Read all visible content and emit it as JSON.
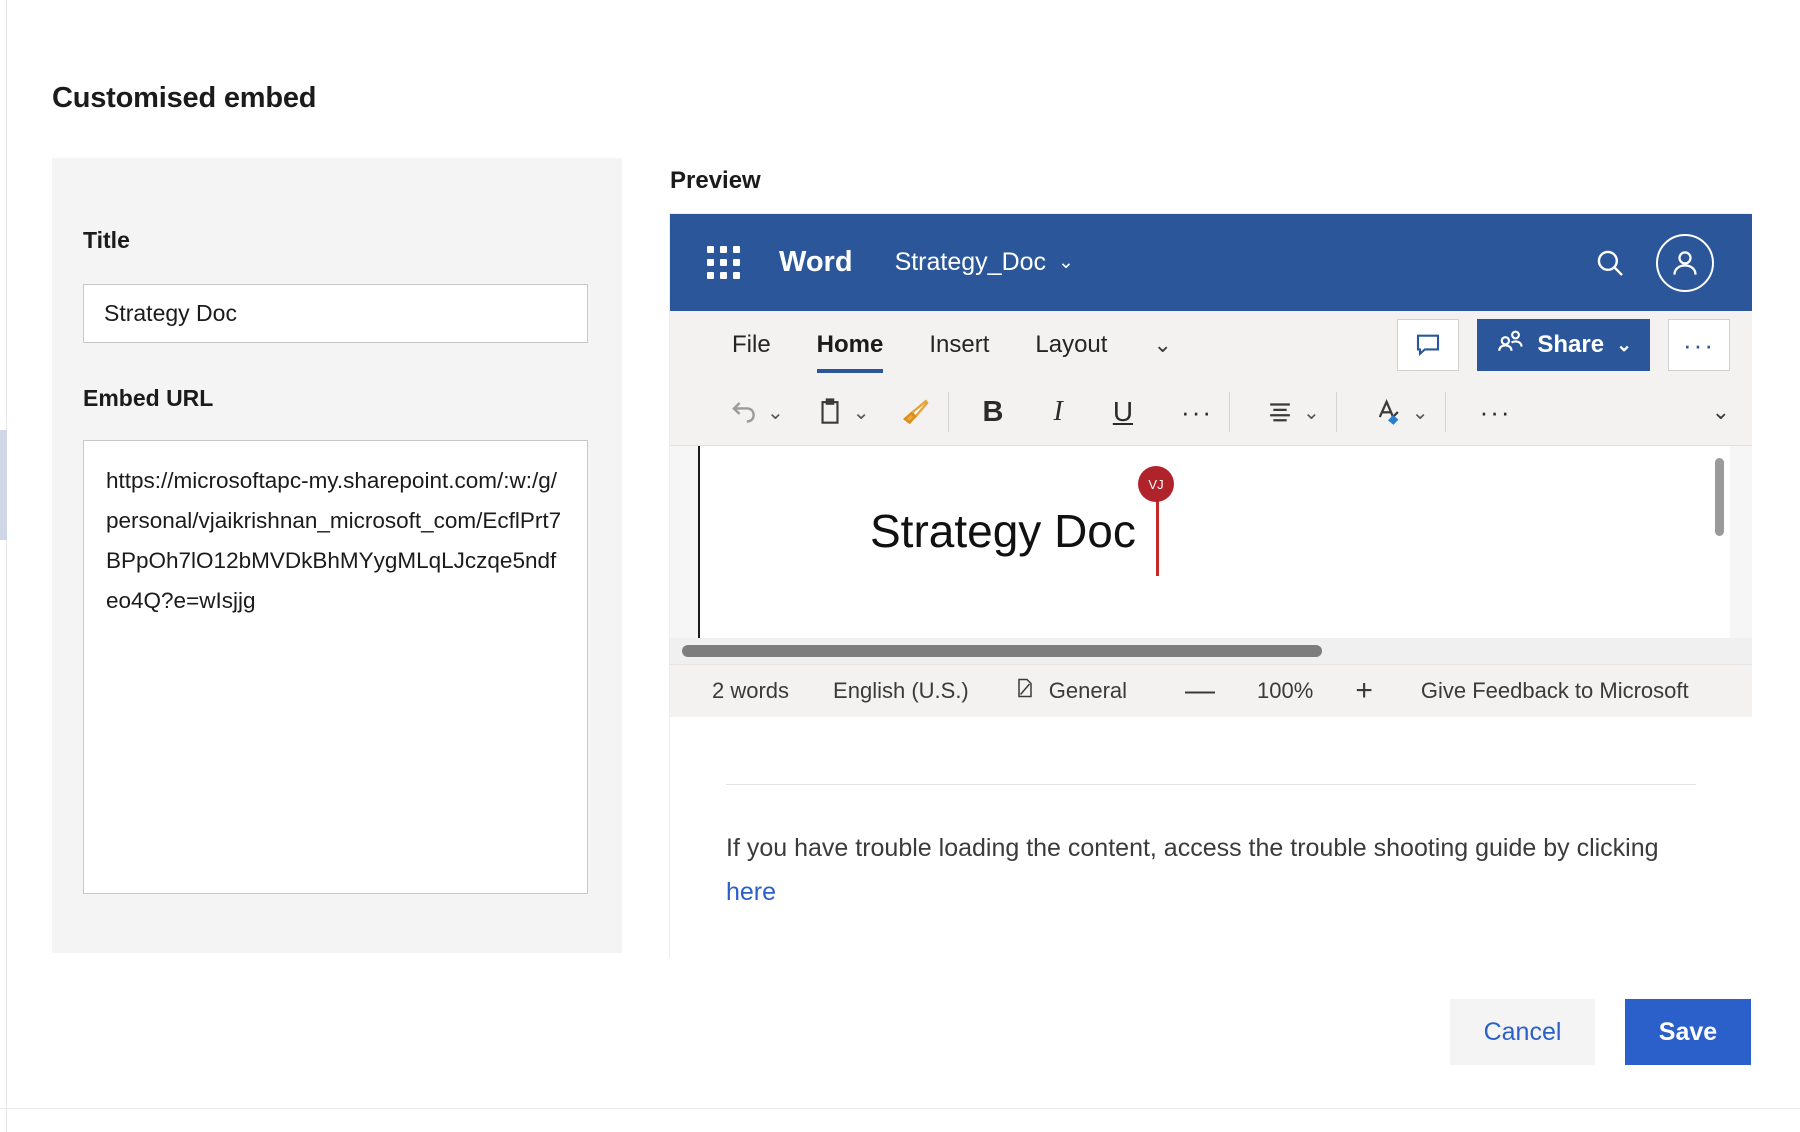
{
  "dialog": {
    "title": "Customised embed",
    "fields": {
      "title_label": "Title",
      "title_value": "Strategy Doc",
      "title_placeholder": "Title",
      "url_label": "Embed URL",
      "url_value": "https://microsoftapc-my.sharepoint.com/:w:/g/personal/vjaikrishnan_microsoft_com/EcflPrt7BPpOh7lO12bMVDkBhMYygMLqLJczqe5ndfeo4Q?e=wIsjjg",
      "url_placeholder": "Embed URL"
    },
    "preview_label": "Preview",
    "actions": {
      "cancel": "Cancel",
      "save": "Save"
    }
  },
  "preview": {
    "titlebar": {
      "waffle_icon": "app-launcher-icon",
      "app_name": "Word",
      "document_name": "Strategy_Doc",
      "document_chevron": "⌄",
      "search_icon": "search-icon",
      "account_icon": "account-avatar-icon"
    },
    "ribbon": {
      "tabs": [
        {
          "label": "File",
          "active": false
        },
        {
          "label": "Home",
          "active": true
        },
        {
          "label": "Insert",
          "active": false
        },
        {
          "label": "Layout",
          "active": false
        }
      ],
      "overflow_chevron": "⌄",
      "comment_icon": "comment-icon",
      "share_label": "Share",
      "share_icon": "share-people-icon",
      "share_chevron": "⌄",
      "more_options": "···"
    },
    "toolbar": {
      "items": [
        {
          "name": "undo-icon",
          "chevron": "⌄"
        },
        {
          "name": "paste-clipboard-icon",
          "chevron": "⌄"
        },
        {
          "name": "format-painter-icon",
          "chevron": ""
        },
        {
          "name": "bold-icon",
          "label": "B"
        },
        {
          "name": "italic-icon",
          "label": "I"
        },
        {
          "name": "underline-icon",
          "label": "U"
        },
        {
          "name": "more-font-options-icon",
          "label": "···"
        },
        {
          "name": "align-icon",
          "chevron": "⌄"
        },
        {
          "name": "text-highlight-icon",
          "chevron": "⌄"
        },
        {
          "name": "more-toolbar-options-icon",
          "label": "···"
        }
      ],
      "collapse_chevron": "⌄"
    },
    "document": {
      "heading": "Strategy Doc",
      "presence_initials": "VJ"
    },
    "statusbar": {
      "word_count": "2 words",
      "language": "English (U.S.)",
      "style_icon": "page-style-icon",
      "style": "General",
      "zoom_out": "—",
      "zoom_level": "100%",
      "zoom_in": "+",
      "feedback": "Give Feedback to Microsoft"
    }
  },
  "fallback": {
    "message_before": "If you have trouble loading the content, access the trouble shooting guide by clicking ",
    "link": "here"
  }
}
